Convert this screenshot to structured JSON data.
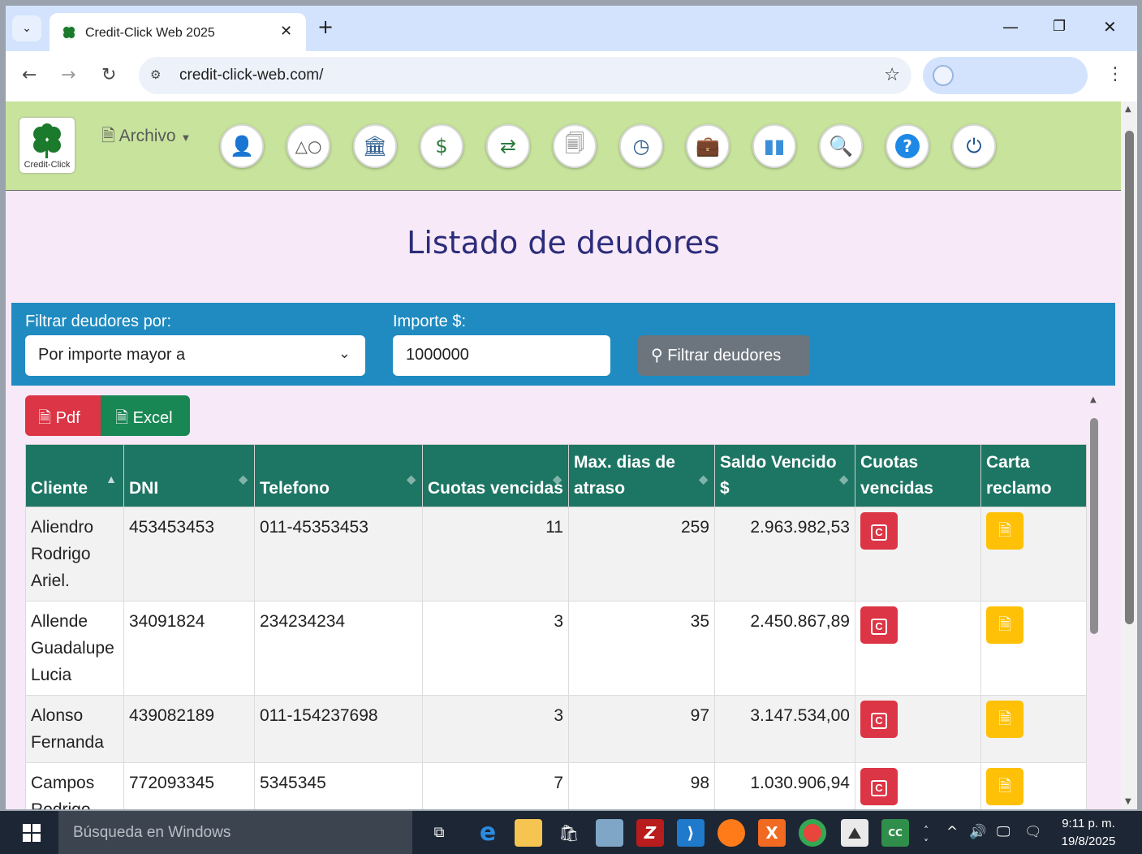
{
  "browser": {
    "tab_title": "Credit-Click Web 2025",
    "url": "credit-click-web.com/"
  },
  "nav": {
    "logo_text": "Credit-Click",
    "archivo_label": "Archivo",
    "icons": [
      "user-icon",
      "shapes-icon",
      "bank-icon",
      "money-icon",
      "transfer-icon",
      "document-icon",
      "clock-icon",
      "briefcase-icon",
      "bar-chart-icon",
      "search-icon",
      "help-icon",
      "power-icon"
    ]
  },
  "page": {
    "title": "Listado de deudores"
  },
  "filter": {
    "label_filter": "Filtrar deudores por:",
    "select_value": "Por importe mayor a",
    "label_amount": "Importe $:",
    "amount_value": "1000000",
    "button_label": "Filtrar deudores"
  },
  "export": {
    "pdf_label": "Pdf",
    "excel_label": "Excel"
  },
  "table": {
    "headers": {
      "cliente": "Cliente",
      "dni": "DNI",
      "telefono": "Telefono",
      "cuotas": "Cuotas vencidas",
      "maxdias": "Max. dias de atraso",
      "saldo": "Saldo Vencido $",
      "cuotas2": "Cuotas vencidas",
      "carta": "Carta reclamo"
    },
    "cuotas_btn_label": "C",
    "rows": [
      {
        "cliente": "Aliendro Rodrigo Ariel.",
        "dni": "453453453",
        "telefono": "011-45353453",
        "cuotas": "11",
        "dias": "259",
        "saldo": "2.963.982,53"
      },
      {
        "cliente": "Allende Guadalupe Lucia",
        "dni": "34091824",
        "telefono": "234234234",
        "cuotas": "3",
        "dias": "35",
        "saldo": "2.450.867,89"
      },
      {
        "cliente": "Alonso Fernanda",
        "dni": "439082189",
        "telefono": "011-154237698",
        "cuotas": "3",
        "dias": "97",
        "saldo": "3.147.534,00"
      },
      {
        "cliente": "Campos Rodrigo",
        "dni": "772093345",
        "telefono": "5345345",
        "cuotas": "7",
        "dias": "98",
        "saldo": "1.030.906,94"
      }
    ]
  },
  "taskbar": {
    "search_placeholder": "Búsqueda en Windows",
    "time": "9:11 p. m.",
    "date": "19/8/2025"
  }
}
